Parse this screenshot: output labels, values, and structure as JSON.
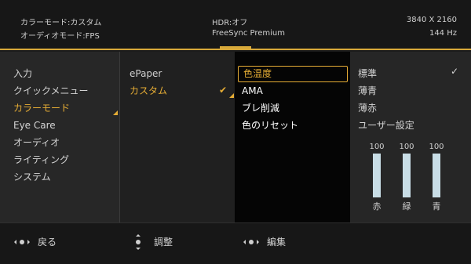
{
  "header": {
    "color_mode": "カラーモード:カスタム",
    "audio_mode": "オーディオモード:FPS",
    "hdr": "HDR:オフ",
    "freesync": "FreeSync Premium",
    "resolution": "3840 X 2160",
    "refresh": "144 Hz"
  },
  "main_menu": {
    "items": [
      "入力",
      "クイックメニュー",
      "カラーモード",
      "Eye Care",
      "オーディオ",
      "ライティング",
      "システム"
    ],
    "active": "カラーモード"
  },
  "sub_menu": {
    "items": [
      "ePaper",
      "カスタム"
    ],
    "active": "カスタム",
    "checked": "カスタム"
  },
  "settings_menu": {
    "items": [
      "色温度",
      "AMA",
      "ブレ削減",
      "色のリセット"
    ],
    "selected": "色温度"
  },
  "value_menu": {
    "items": [
      "標準",
      "薄青",
      "薄赤",
      "ユーザー設定"
    ],
    "checked": "標準",
    "rgb": [
      {
        "label": "赤",
        "value": "100",
        "level": 1.0
      },
      {
        "label": "緑",
        "value": "100",
        "level": 1.0
      },
      {
        "label": "青",
        "value": "100",
        "level": 1.0
      }
    ]
  },
  "footer": {
    "back": "戻る",
    "adjust": "調整",
    "edit": "編集"
  },
  "colors": {
    "accent": "#e6ad35",
    "bar": "#c8dde6"
  },
  "icons": {
    "check": "check-icon",
    "joystick": "joystick-icon"
  }
}
